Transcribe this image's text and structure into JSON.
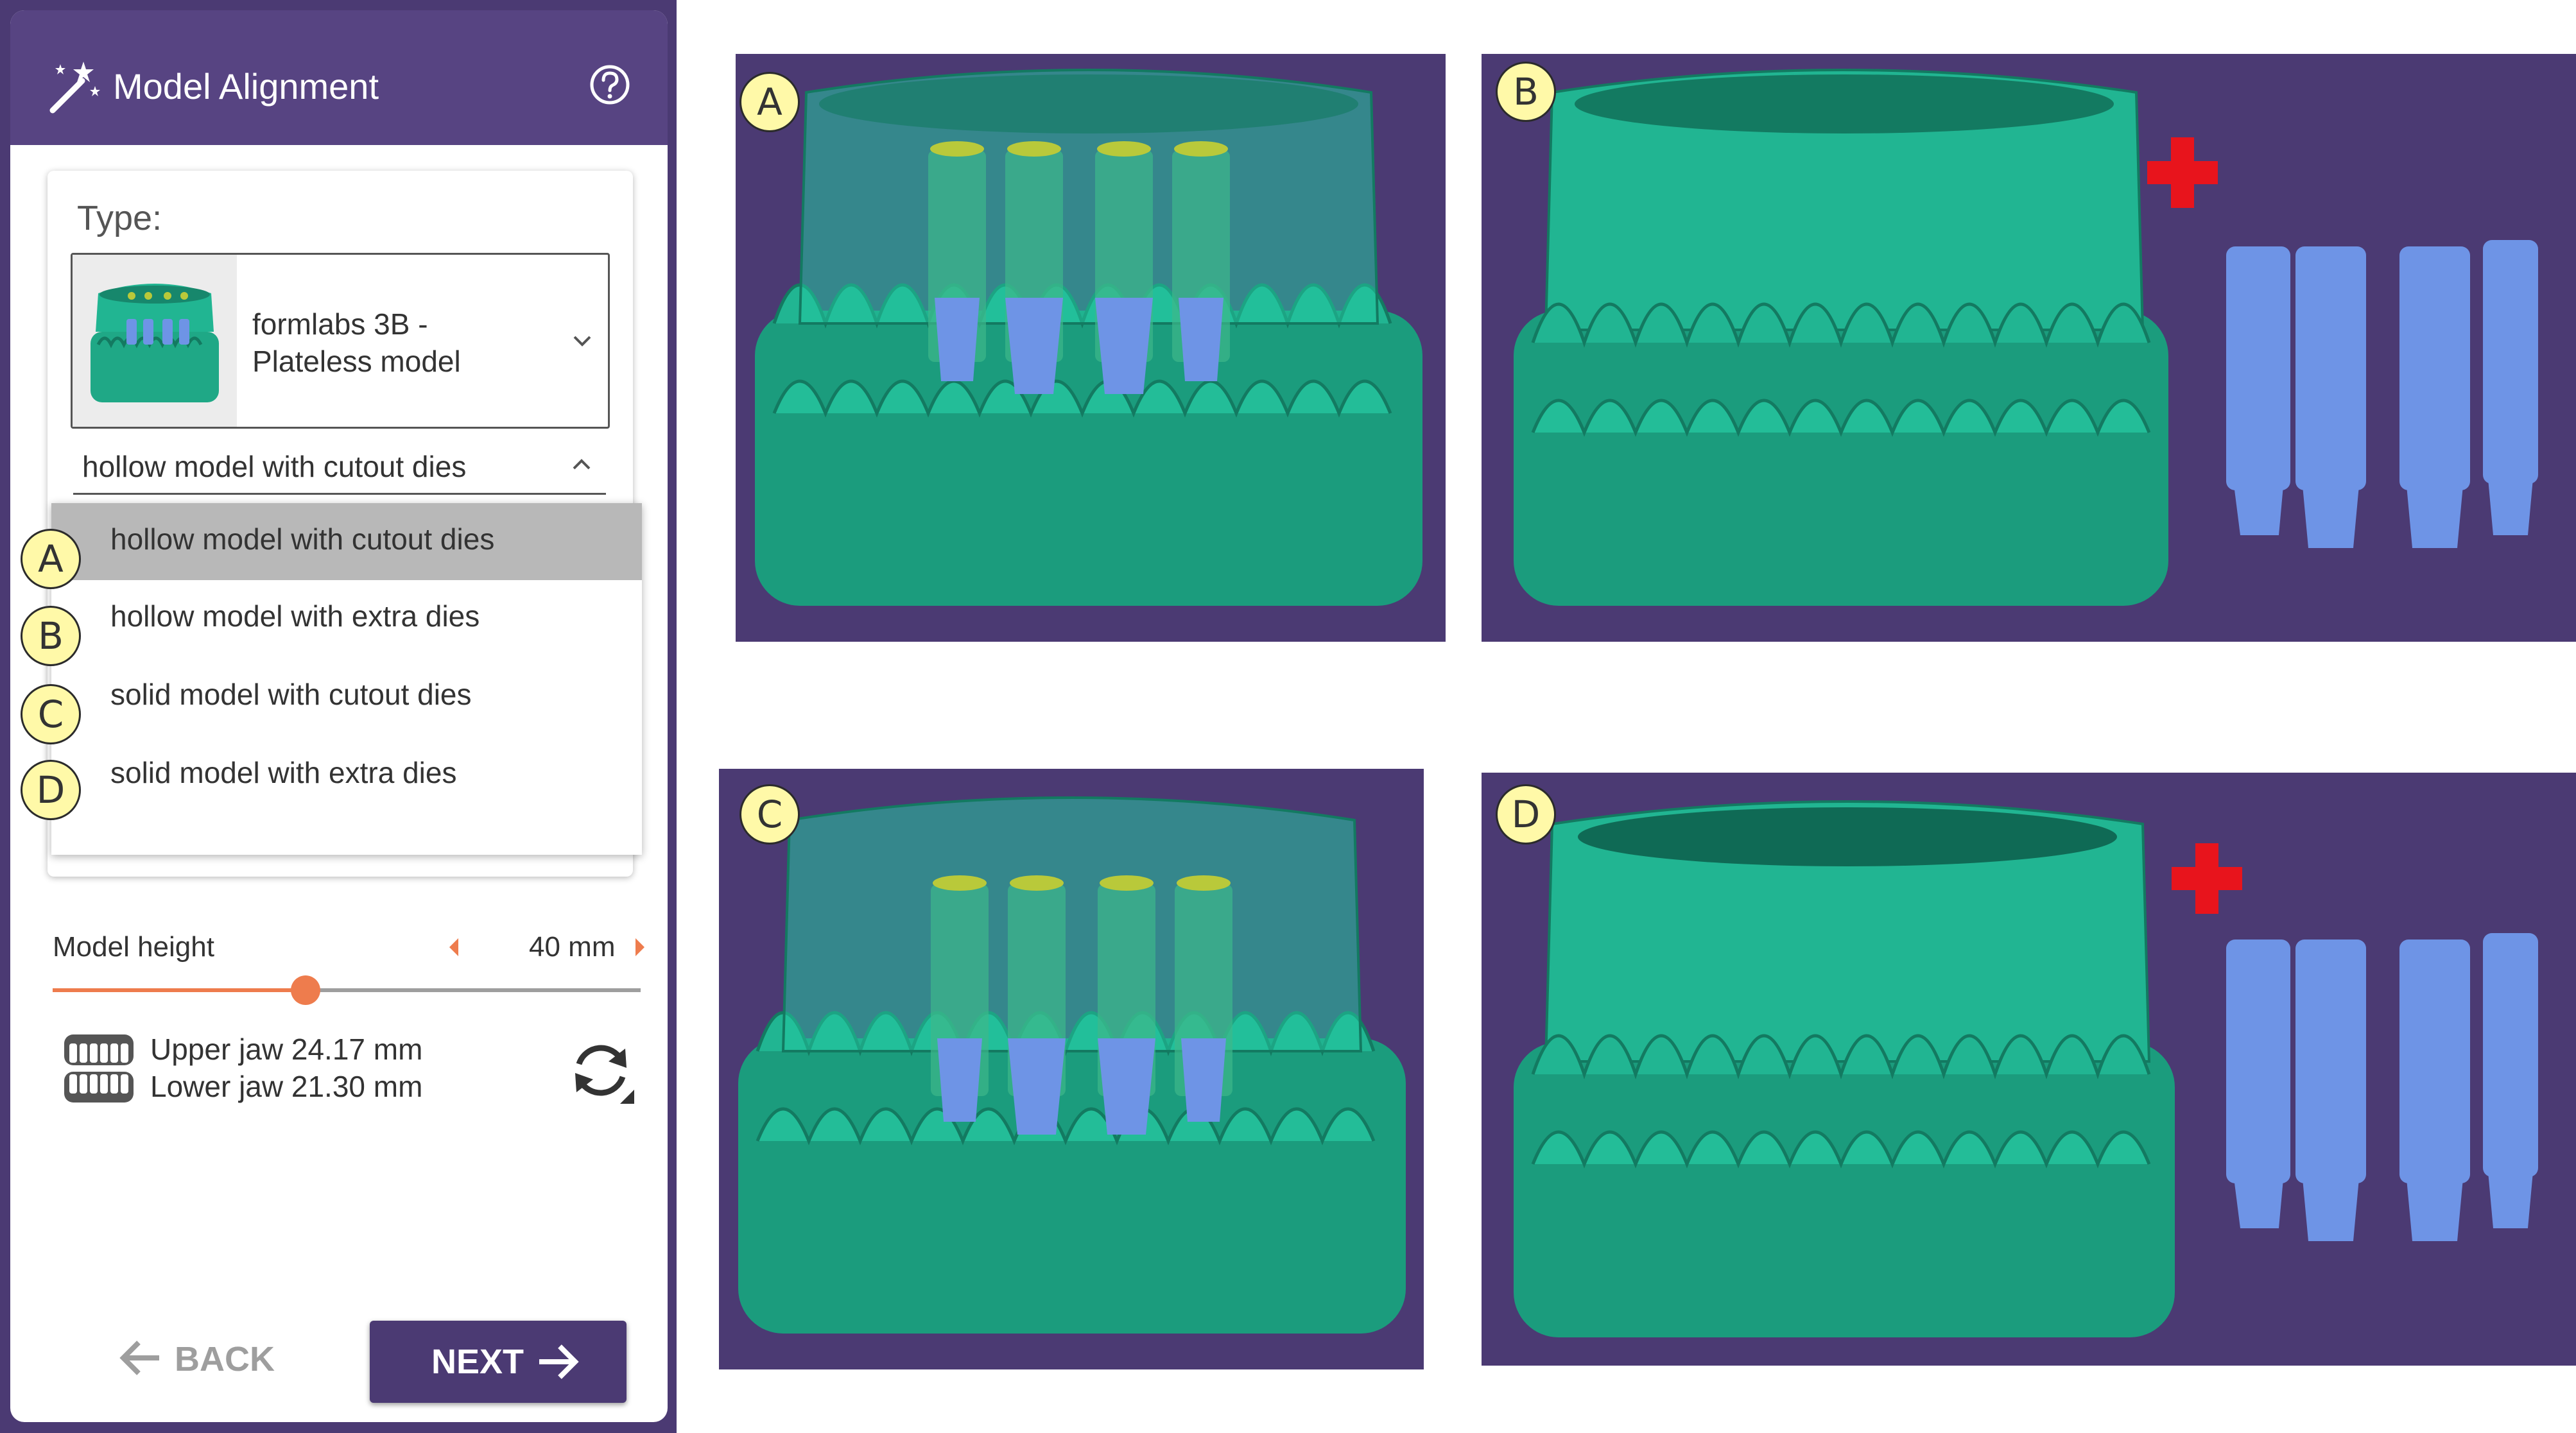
{
  "header": {
    "title": "Model Alignment",
    "icon": "magic-wand-icon",
    "help_icon": "help-icon"
  },
  "type_section": {
    "label": "Type:",
    "model": {
      "name_line1": "formlabs 3B -",
      "name_line2": "Plateless model"
    },
    "subtype": {
      "selected": "hollow model with cutout dies"
    }
  },
  "dropdown": {
    "items": [
      {
        "badge": "A",
        "label": "hollow model with cutout dies",
        "selected": true
      },
      {
        "badge": "B",
        "label": "hollow model with extra dies",
        "selected": false
      },
      {
        "badge": "C",
        "label": "solid model with cutout dies",
        "selected": false
      },
      {
        "badge": "D",
        "label": "solid model with extra dies",
        "selected": false
      }
    ]
  },
  "model_height": {
    "label": "Model height",
    "value": "40 mm",
    "slider_fraction": 0.43
  },
  "jaw_info": {
    "upper": "Upper jaw 24.17 mm",
    "lower": "Lower jaw 21.30 mm"
  },
  "buttons": {
    "back": "BACK",
    "next": "NEXT"
  },
  "previews": [
    {
      "badge": "A",
      "variant": "hollow model with cutout dies"
    },
    {
      "badge": "B",
      "variant": "hollow model with extra dies"
    },
    {
      "badge": "C",
      "variant": "solid model with cutout dies"
    },
    {
      "badge": "D",
      "variant": "solid model with extra dies"
    }
  ],
  "colors": {
    "purple": "#4b3a73",
    "header_purple": "#574482",
    "model_teal": "#21b592",
    "die_blue": "#6e94e6",
    "accent_orange": "#ee7c4d",
    "plus_red": "#e8141c",
    "badge_yellow": "#fff9a8"
  }
}
